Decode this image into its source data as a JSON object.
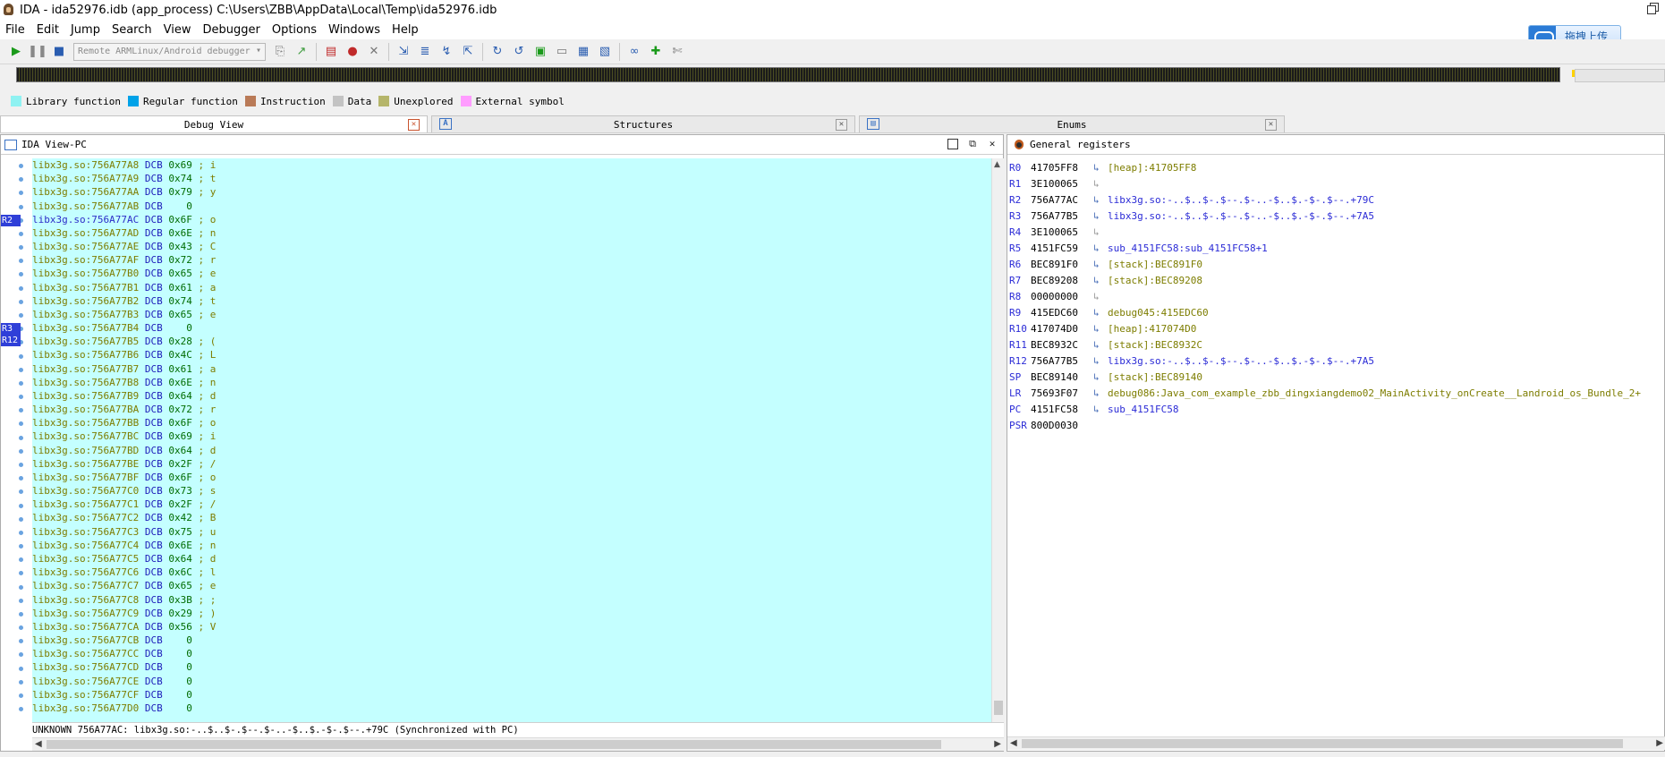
{
  "window": {
    "title": "IDA - ida52976.idb (app_process) C:\\Users\\ZBB\\AppData\\Local\\Temp\\ida52976.idb"
  },
  "menu": [
    "File",
    "Edit",
    "Jump",
    "Search",
    "View",
    "Debugger",
    "Options",
    "Windows",
    "Help"
  ],
  "upload_button": "拖拽上传",
  "toolbar": {
    "debugger_select": "Remote ARMLinux/Android debugger",
    "icons": [
      "play-icon",
      "pause-icon",
      "stop-icon",
      "attach-icon",
      "detach-icon",
      "breakpoint-icon",
      "add-breakpoint-icon",
      "delete-breakpoint-icon",
      "step-into-icon",
      "step-over-icon",
      "run-to-cursor-icon",
      "step-out-icon",
      "trace-icon",
      "function-trace-icon",
      "watch-icon",
      "locals-icon",
      "tracing-icon",
      "add-trace-icon",
      "clear-trace-icon"
    ]
  },
  "legend": [
    {
      "label": "Library function",
      "color": "#8ff2f2"
    },
    {
      "label": "Regular function",
      "color": "#00a2e8"
    },
    {
      "label": "Instruction",
      "color": "#b97a57"
    },
    {
      "label": "Data",
      "color": "#c3c3c3"
    },
    {
      "label": "Unexplored",
      "color": "#b5b56a"
    },
    {
      "label": "External symbol",
      "color": "#ff9cff"
    }
  ],
  "tabs": [
    {
      "label": "Debug View",
      "active": true
    },
    {
      "label": "Structures",
      "active": false
    },
    {
      "label": "Enums",
      "active": false
    }
  ],
  "ida_view": {
    "title": "IDA View-PC",
    "markers": [
      {
        "label": "R2",
        "row": 4
      },
      {
        "label": "R3",
        "row": 12
      },
      {
        "label": "R12",
        "row": 12
      }
    ],
    "lines": [
      {
        "addr": "libx3g.so:756A77A8",
        "mn": "DCB",
        "op": "0x69",
        "cmt": "; i"
      },
      {
        "addr": "libx3g.so:756A77A9",
        "mn": "DCB",
        "op": "0x74",
        "cmt": "; t"
      },
      {
        "addr": "libx3g.so:756A77AA",
        "mn": "DCB",
        "op": "0x79",
        "cmt": "; y"
      },
      {
        "addr": "libx3g.so:756A77AB",
        "mn": "DCB",
        "op": "   0",
        "cmt": ""
      },
      {
        "addr": "libx3g.so:756A77AC",
        "mn": "DCB",
        "op": "0x6F",
        "cmt": "; o",
        "hl": true
      },
      {
        "addr": "libx3g.so:756A77AD",
        "mn": "DCB",
        "op": "0x6E",
        "cmt": "; n"
      },
      {
        "addr": "libx3g.so:756A77AE",
        "mn": "DCB",
        "op": "0x43",
        "cmt": "; C"
      },
      {
        "addr": "libx3g.so:756A77AF",
        "mn": "DCB",
        "op": "0x72",
        "cmt": "; r"
      },
      {
        "addr": "libx3g.so:756A77B0",
        "mn": "DCB",
        "op": "0x65",
        "cmt": "; e"
      },
      {
        "addr": "libx3g.so:756A77B1",
        "mn": "DCB",
        "op": "0x61",
        "cmt": "; a"
      },
      {
        "addr": "libx3g.so:756A77B2",
        "mn": "DCB",
        "op": "0x74",
        "cmt": "; t"
      },
      {
        "addr": "libx3g.so:756A77B3",
        "mn": "DCB",
        "op": "0x65",
        "cmt": "; e"
      },
      {
        "addr": "libx3g.so:756A77B4",
        "mn": "DCB",
        "op": "   0",
        "cmt": ""
      },
      {
        "addr": "libx3g.so:756A77B5",
        "mn": "DCB",
        "op": "0x28",
        "cmt": "; ("
      },
      {
        "addr": "libx3g.so:756A77B6",
        "mn": "DCB",
        "op": "0x4C",
        "cmt": "; L"
      },
      {
        "addr": "libx3g.so:756A77B7",
        "mn": "DCB",
        "op": "0x61",
        "cmt": "; a"
      },
      {
        "addr": "libx3g.so:756A77B8",
        "mn": "DCB",
        "op": "0x6E",
        "cmt": "; n"
      },
      {
        "addr": "libx3g.so:756A77B9",
        "mn": "DCB",
        "op": "0x64",
        "cmt": "; d"
      },
      {
        "addr": "libx3g.so:756A77BA",
        "mn": "DCB",
        "op": "0x72",
        "cmt": "; r"
      },
      {
        "addr": "libx3g.so:756A77BB",
        "mn": "DCB",
        "op": "0x6F",
        "cmt": "; o"
      },
      {
        "addr": "libx3g.so:756A77BC",
        "mn": "DCB",
        "op": "0x69",
        "cmt": "; i"
      },
      {
        "addr": "libx3g.so:756A77BD",
        "mn": "DCB",
        "op": "0x64",
        "cmt": "; d"
      },
      {
        "addr": "libx3g.so:756A77BE",
        "mn": "DCB",
        "op": "0x2F",
        "cmt": "; /"
      },
      {
        "addr": "libx3g.so:756A77BF",
        "mn": "DCB",
        "op": "0x6F",
        "cmt": "; o"
      },
      {
        "addr": "libx3g.so:756A77C0",
        "mn": "DCB",
        "op": "0x73",
        "cmt": "; s"
      },
      {
        "addr": "libx3g.so:756A77C1",
        "mn": "DCB",
        "op": "0x2F",
        "cmt": "; /"
      },
      {
        "addr": "libx3g.so:756A77C2",
        "mn": "DCB",
        "op": "0x42",
        "cmt": "; B"
      },
      {
        "addr": "libx3g.so:756A77C3",
        "mn": "DCB",
        "op": "0x75",
        "cmt": "; u"
      },
      {
        "addr": "libx3g.so:756A77C4",
        "mn": "DCB",
        "op": "0x6E",
        "cmt": "; n"
      },
      {
        "addr": "libx3g.so:756A77C5",
        "mn": "DCB",
        "op": "0x64",
        "cmt": "; d"
      },
      {
        "addr": "libx3g.so:756A77C6",
        "mn": "DCB",
        "op": "0x6C",
        "cmt": "; l"
      },
      {
        "addr": "libx3g.so:756A77C7",
        "mn": "DCB",
        "op": "0x65",
        "cmt": "; e"
      },
      {
        "addr": "libx3g.so:756A77C8",
        "mn": "DCB",
        "op": "0x3B",
        "cmt": "; ;"
      },
      {
        "addr": "libx3g.so:756A77C9",
        "mn": "DCB",
        "op": "0x29",
        "cmt": "; )"
      },
      {
        "addr": "libx3g.so:756A77CA",
        "mn": "DCB",
        "op": "0x56",
        "cmt": "; V"
      },
      {
        "addr": "libx3g.so:756A77CB",
        "mn": "DCB",
        "op": "   0",
        "cmt": ""
      },
      {
        "addr": "libx3g.so:756A77CC",
        "mn": "DCB",
        "op": "   0",
        "cmt": ""
      },
      {
        "addr": "libx3g.so:756A77CD",
        "mn": "DCB",
        "op": "   0",
        "cmt": ""
      },
      {
        "addr": "libx3g.so:756A77CE",
        "mn": "DCB",
        "op": "   0",
        "cmt": ""
      },
      {
        "addr": "libx3g.so:756A77CF",
        "mn": "DCB",
        "op": "   0",
        "cmt": ""
      },
      {
        "addr": "libx3g.so:756A77D0",
        "mn": "DCB",
        "op": "   0",
        "cmt": ""
      }
    ],
    "status": "UNKNOWN 756A77AC: libx3g.so:-..$..$-.$--.$-..-$..$.-$-.$--.+79C (Synchronized with PC)"
  },
  "registers": {
    "title": "General registers",
    "rows": [
      {
        "name": "R0",
        "value": "41705FF8",
        "desc": "[heap]:41705FF8",
        "kind": "heap"
      },
      {
        "name": "R1",
        "value": "3E100065",
        "desc": "",
        "kind": "none"
      },
      {
        "name": "R2",
        "value": "756A77AC",
        "desc": "libx3g.so:-..$..$-.$--.$-..-$..$.-$-.$--.+79C",
        "kind": "lib"
      },
      {
        "name": "R3",
        "value": "756A77B5",
        "desc": "libx3g.so:-..$..$-.$--.$-..-$..$.-$-.$--.+7A5",
        "kind": "lib"
      },
      {
        "name": "R4",
        "value": "3E100065",
        "desc": "",
        "kind": "none"
      },
      {
        "name": "R5",
        "value": "4151FC59",
        "desc": "sub_4151FC58:sub_4151FC58+1",
        "kind": "sub"
      },
      {
        "name": "R6",
        "value": "BEC891F0",
        "desc": "[stack]:BEC891F0",
        "kind": "stack"
      },
      {
        "name": "R7",
        "value": "BEC89208",
        "desc": "[stack]:BEC89208",
        "kind": "stack"
      },
      {
        "name": "R8",
        "value": "00000000",
        "desc": "",
        "kind": "none"
      },
      {
        "name": "R9",
        "value": "415EDC60",
        "desc": "debug045:415EDC60",
        "kind": "dbg"
      },
      {
        "name": "R10",
        "value": "417074D0",
        "desc": "[heap]:417074D0",
        "kind": "heap"
      },
      {
        "name": "R11",
        "value": "BEC8932C",
        "desc": "[stack]:BEC8932C",
        "kind": "stack"
      },
      {
        "name": "R12",
        "value": "756A77B5",
        "desc": "libx3g.so:-..$..$-.$--.$-..-$..$.-$-.$--.+7A5",
        "kind": "lib"
      },
      {
        "name": "SP",
        "value": "BEC89140",
        "desc": "[stack]:BEC89140",
        "kind": "stack"
      },
      {
        "name": "LR",
        "value": "75693F07",
        "desc": "debug086:Java_com_example_zbb_dingxiangdemo02_MainActivity_onCreate__Landroid_os_Bundle_2+",
        "kind": "dbg"
      },
      {
        "name": "PC",
        "value": "4151FC58",
        "desc": "sub_4151FC58",
        "kind": "sub"
      },
      {
        "name": "PSR",
        "value": "800D0030",
        "desc": null,
        "kind": "psr"
      }
    ]
  }
}
